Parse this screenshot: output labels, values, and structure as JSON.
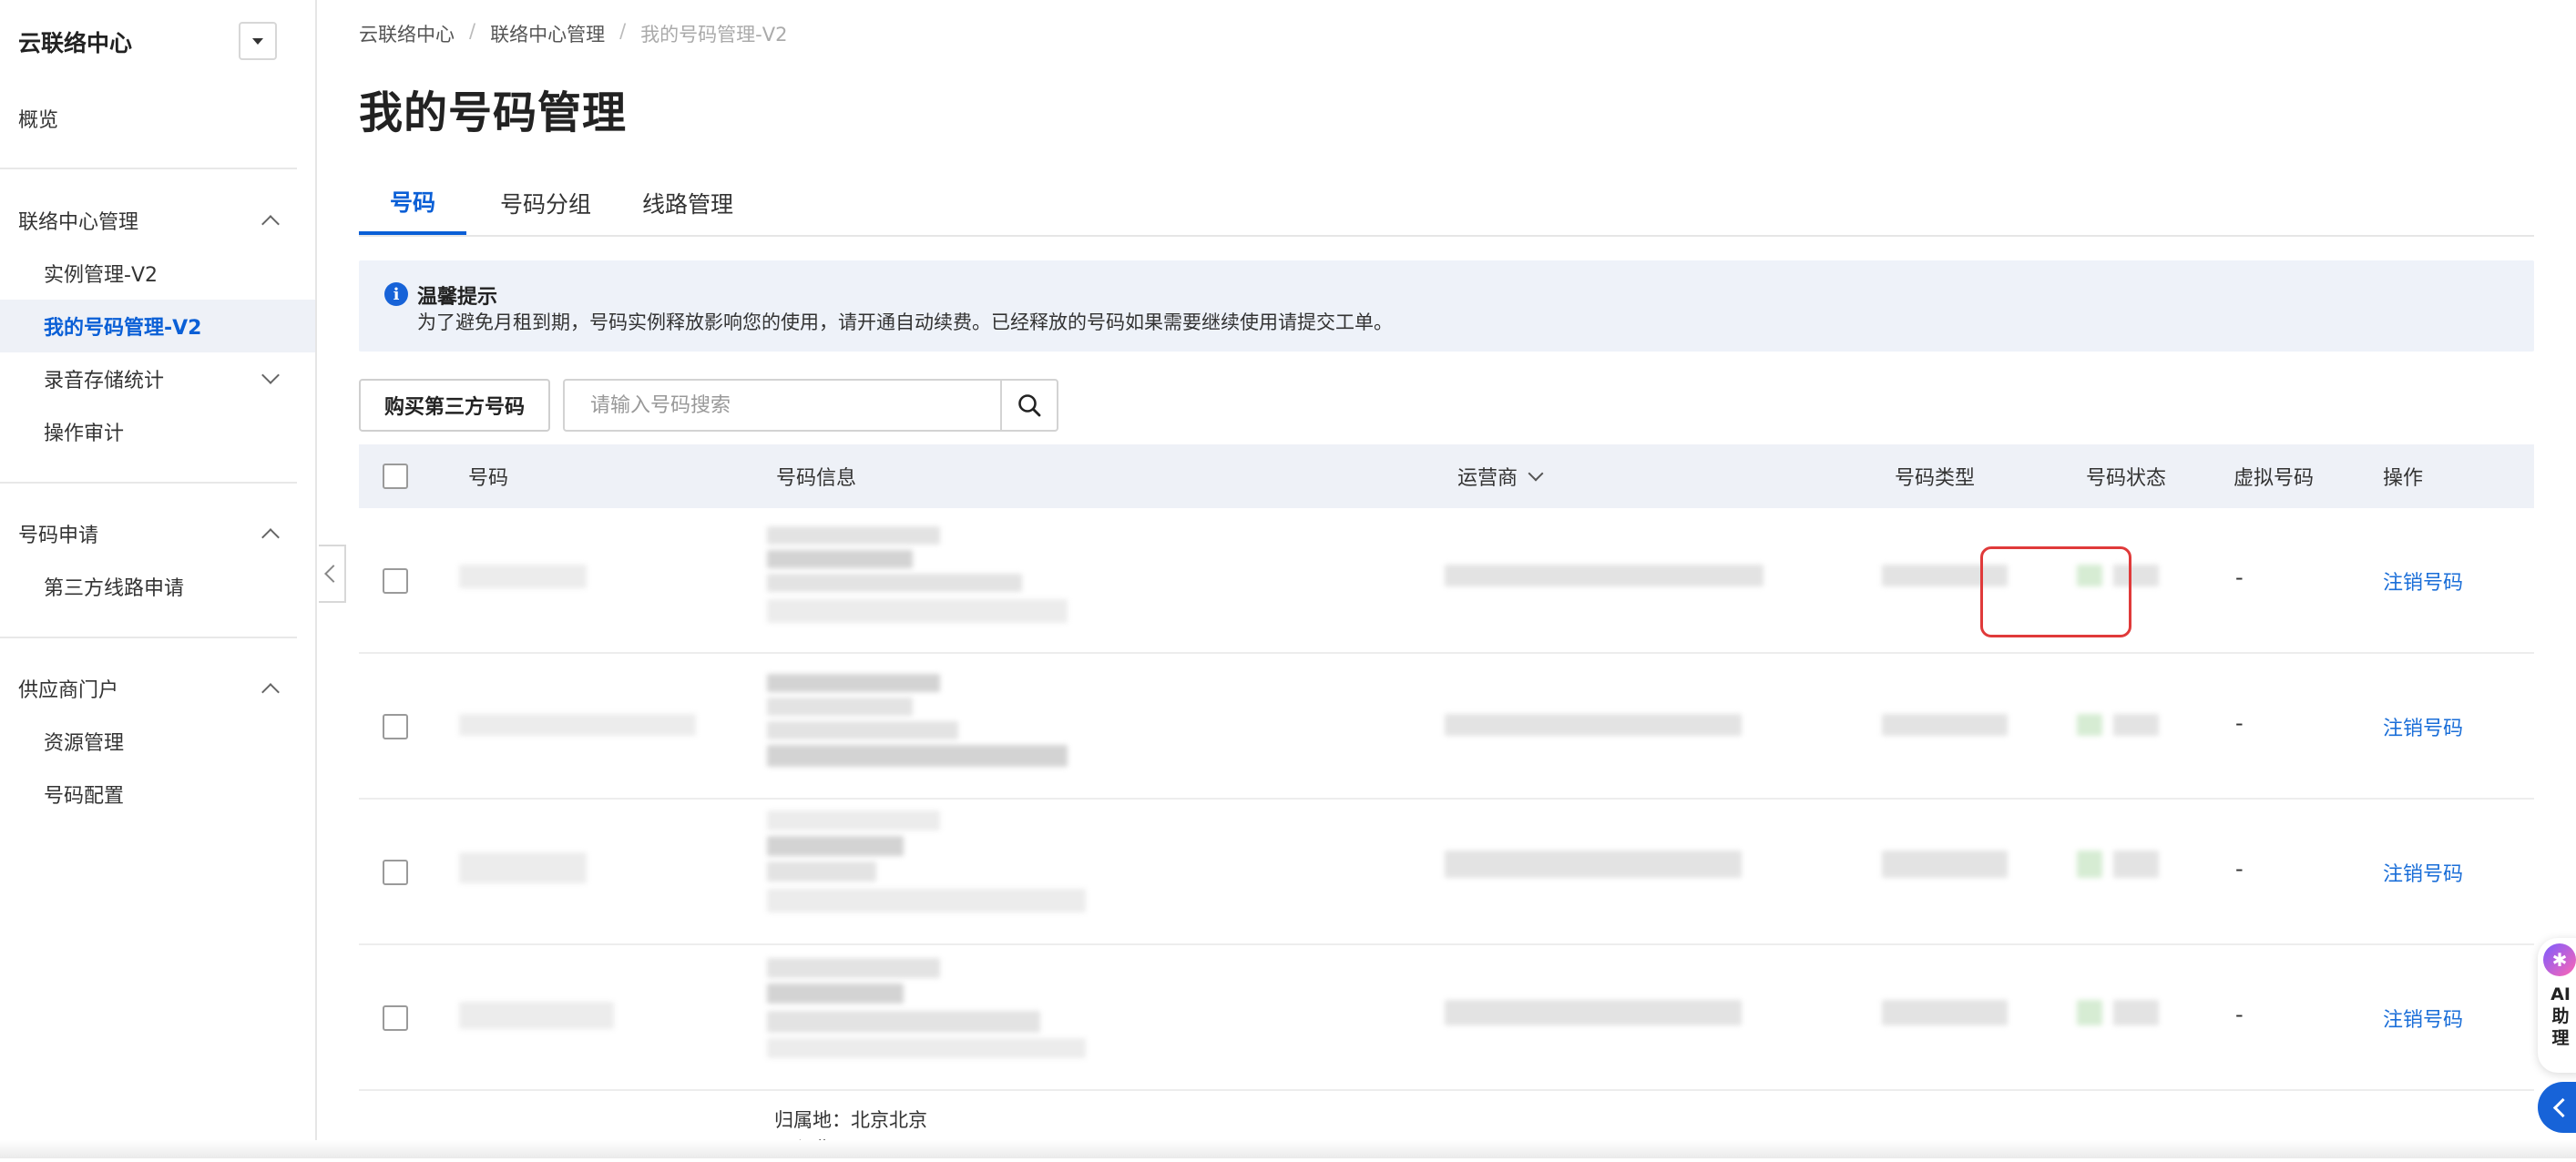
{
  "sidebar": {
    "title": "云联络中心",
    "overview": "概览",
    "groups": [
      {
        "label": "联络中心管理",
        "items": [
          "实例管理-V2",
          "我的号码管理-V2",
          "录音存储统计",
          "操作审计"
        ]
      },
      {
        "label": "号码申请",
        "items": [
          "第三方线路申请"
        ]
      },
      {
        "label": "供应商门户",
        "items": [
          "资源管理",
          "号码配置"
        ]
      }
    ]
  },
  "breadcrumb": [
    "云联络中心",
    "联络中心管理",
    "我的号码管理-V2"
  ],
  "breadcrumb_sep": "/",
  "page_title": "我的号码管理",
  "tabs": [
    "号码",
    "号码分组",
    "线路管理"
  ],
  "notice": {
    "title": "温馨提示",
    "body": "为了避免月租到期，号码实例释放影响您的使用，请开通自动续费。已经释放的号码如果需要继续使用请提交工单。"
  },
  "toolbar": {
    "buy_label": "购买第三方号码",
    "search_placeholder": "请输入号码搜索"
  },
  "table": {
    "headers": [
      "号码",
      "号码信息",
      "运营商",
      "号码类型",
      "号码状态",
      "虚拟号码",
      "操作"
    ],
    "rows": [
      {
        "virtual": "-",
        "action": "注销号码"
      },
      {
        "virtual": "-",
        "action": "注销号码"
      },
      {
        "virtual": "-",
        "action": "注销号码"
      },
      {
        "virtual": "-",
        "action": "注销号码"
      }
    ],
    "partial_row": {
      "location": "归属地：北京北京",
      "monthly_fee": "月租费：元/月"
    }
  },
  "ai_helper": {
    "label": "AI助理"
  },
  "colors": {
    "accent": "#0a5fd6",
    "link": "#1a6ed8",
    "highlight": "#e03a3a"
  }
}
